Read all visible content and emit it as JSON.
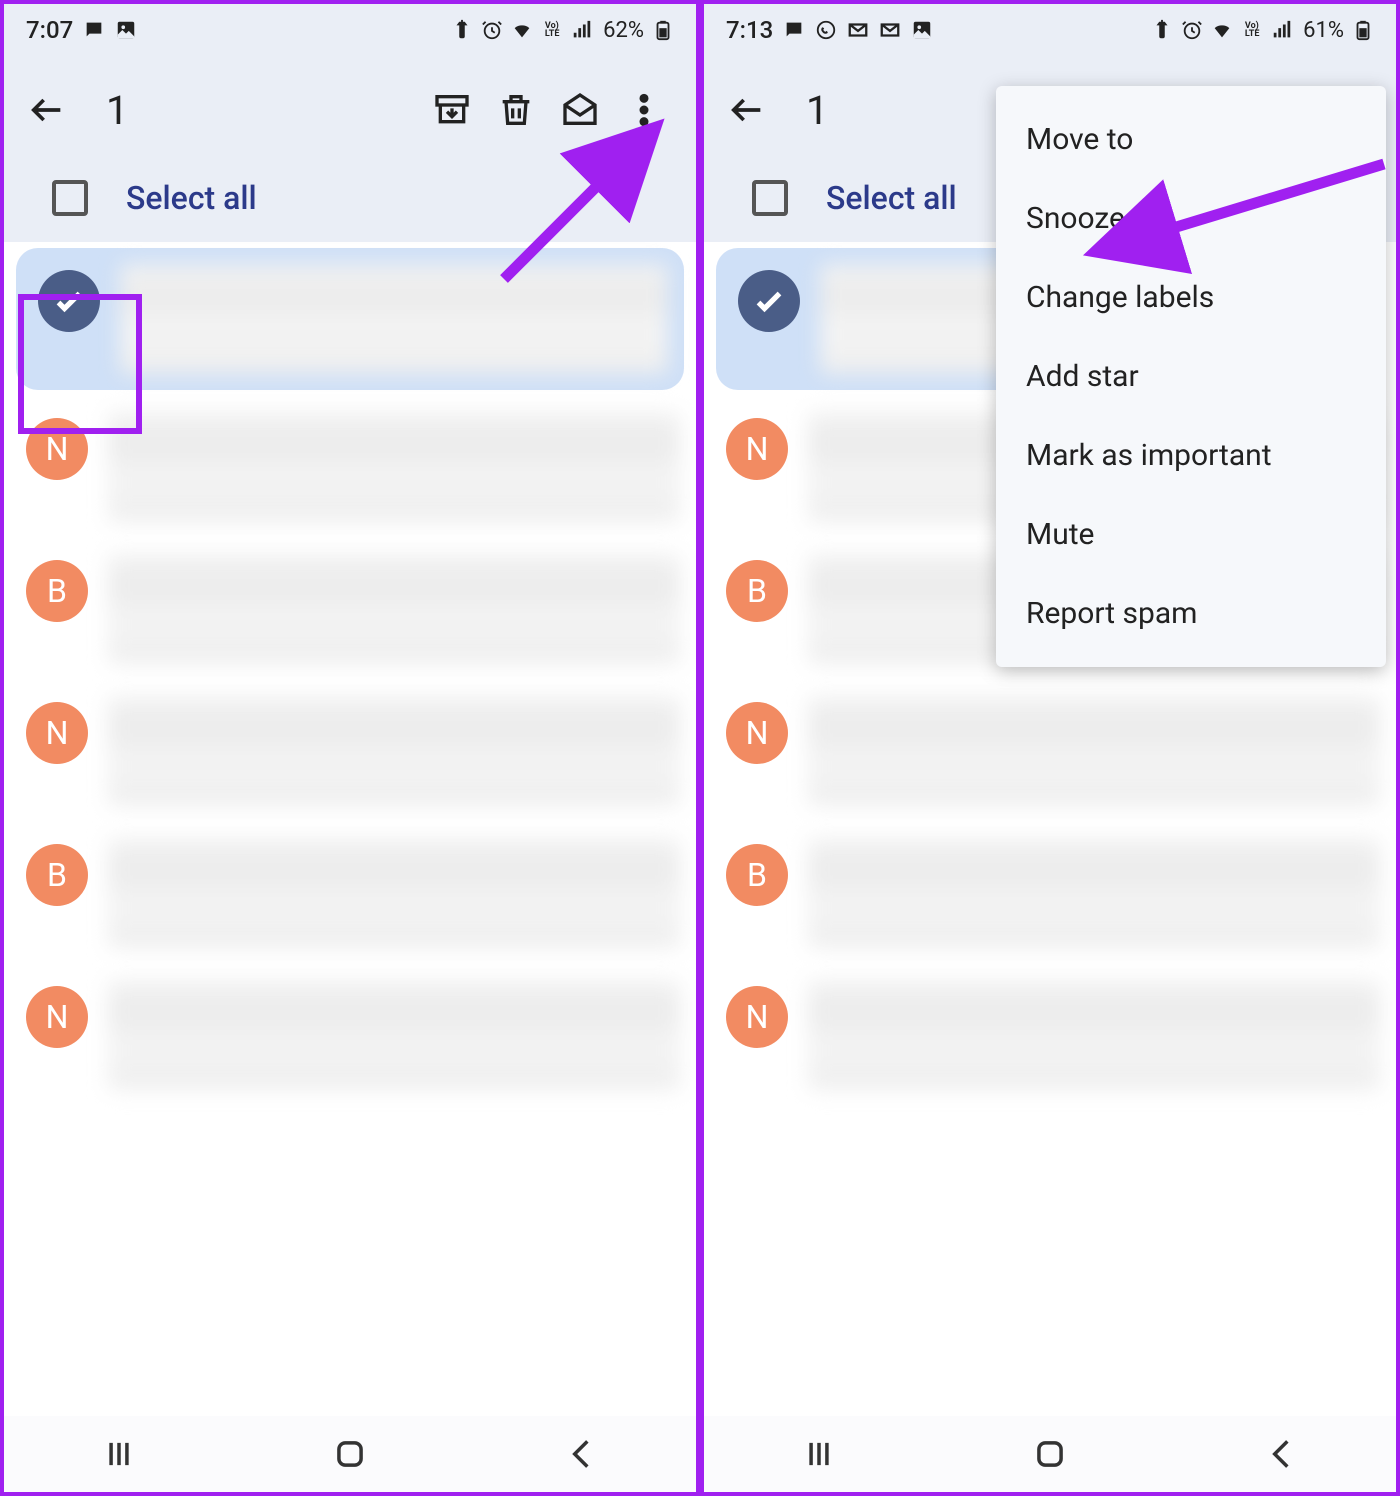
{
  "left": {
    "status": {
      "time": "7:07",
      "battery": "62%"
    },
    "appbar": {
      "count": "1"
    },
    "select_all": "Select all",
    "avatars": [
      "check",
      "N",
      "B",
      "N",
      "B",
      "N"
    ]
  },
  "right": {
    "status": {
      "time": "7:13",
      "battery": "61%"
    },
    "appbar": {
      "count": "1"
    },
    "select_all": "Select all",
    "avatars": [
      "check",
      "N",
      "B",
      "N",
      "B",
      "N"
    ],
    "menu": {
      "items": [
        "Move to",
        "Snooze",
        "Change labels",
        "Add star",
        "Mark as important",
        "Mute",
        "Report spam"
      ]
    }
  },
  "annotation": {
    "accent": "#a020f0"
  }
}
